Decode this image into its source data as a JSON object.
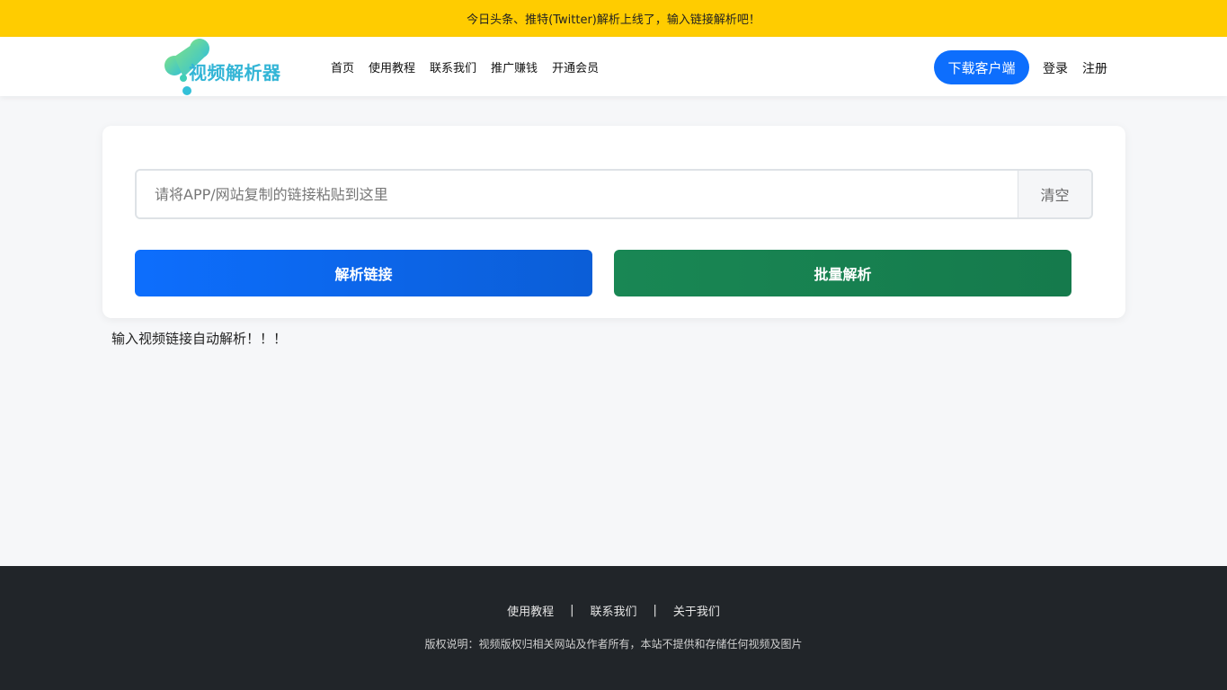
{
  "announcement": "今日头条、推特(Twitter)解析上线了，输入链接解析吧！",
  "logo": {
    "text": "视频解析器",
    "icon": "droplet-logo-icon"
  },
  "nav": {
    "items": [
      {
        "label": "首页"
      },
      {
        "label": "使用教程"
      },
      {
        "label": "联系我们"
      },
      {
        "label": "推广赚钱"
      },
      {
        "label": "开通会员"
      }
    ],
    "download_label": "下载客户端",
    "login_label": "登录",
    "register_label": "注册"
  },
  "main": {
    "input_placeholder": "请将APP/网站复制的链接粘贴到这里",
    "input_value": "",
    "clear_label": "清空",
    "parse_label": "解析链接",
    "batch_label": "批量解析",
    "hint": "输入视频链接自动解析！！！"
  },
  "footer": {
    "links": [
      {
        "label": "使用教程"
      },
      {
        "label": "联系我们"
      },
      {
        "label": "关于我们"
      }
    ],
    "separator": "|",
    "copyright": "版权说明：视频版权归相关网站及作者所有，本站不提供和存储任何视频及图片"
  },
  "colors": {
    "announcement_bg": "#ffcc00",
    "primary": "#0d6efd",
    "success": "#198754",
    "footer_bg": "#212529",
    "logo_text": "#33b5d6"
  }
}
